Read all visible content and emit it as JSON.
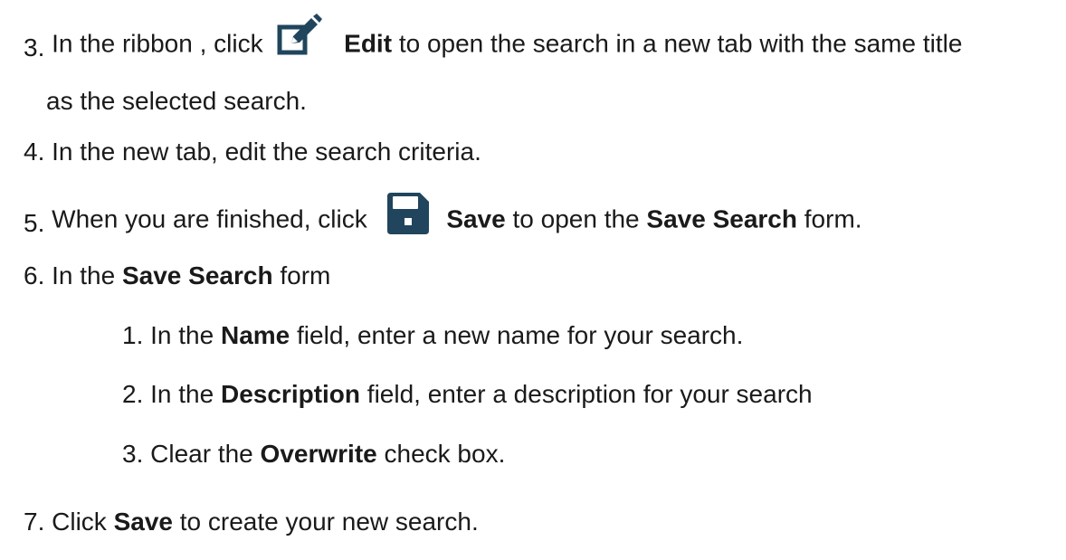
{
  "colors": {
    "text": "#1a1a1a",
    "icon": "#20455c"
  },
  "icons": {
    "edit": "edit-icon",
    "save": "save-icon"
  },
  "steps": [
    {
      "num": "3.",
      "parts": [
        "In the ribbon , click",
        "Edit",
        "to open the search in a new tab with the same title"
      ],
      "continuation": "as the selected search."
    },
    {
      "num": "4.",
      "text": "In the new tab, edit the search criteria."
    },
    {
      "num": "5.",
      "parts": [
        "When you are finished, click",
        "Save",
        "to open the",
        "Save Search",
        "form."
      ]
    },
    {
      "num": "6.",
      "parts": [
        "In the",
        "Save Search",
        "form"
      ],
      "substeps": [
        {
          "num": "1.",
          "parts": [
            "In the",
            "Name",
            "field, enter a new name for your search."
          ]
        },
        {
          "num": "2.",
          "parts": [
            "In the",
            "Description",
            "field, enter a description for your search"
          ]
        },
        {
          "num": "3.",
          "parts": [
            "Clear the",
            "Overwrite",
            "check box."
          ]
        }
      ]
    },
    {
      "num": "7.",
      "parts": [
        "Click",
        "Save",
        "to create your new search."
      ]
    }
  ]
}
